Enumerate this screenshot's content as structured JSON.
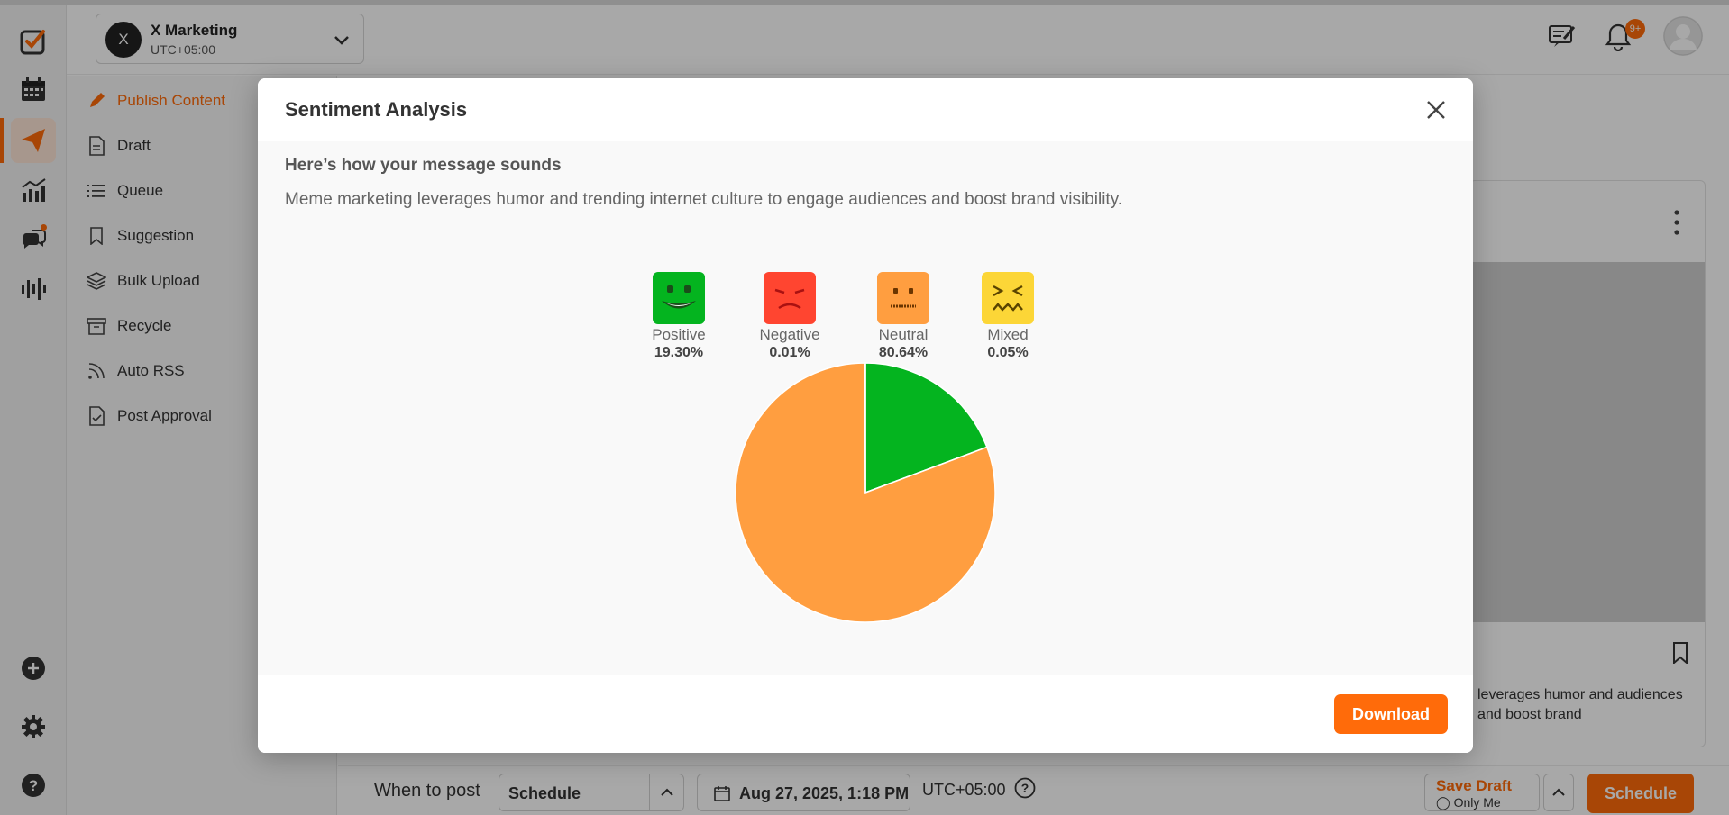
{
  "workspace": {
    "initial": "X",
    "name": "X Marketing",
    "timezone": "UTC+05:00"
  },
  "header": {
    "notification_badge": "9+"
  },
  "subnav": {
    "items": [
      {
        "label": "Publish Content",
        "icon": "pencil-icon",
        "active": true
      },
      {
        "label": "Draft",
        "icon": "document-icon"
      },
      {
        "label": "Queue",
        "icon": "list-icon"
      },
      {
        "label": "Suggestion",
        "icon": "bookmark-icon"
      },
      {
        "label": "Bulk Upload",
        "icon": "layers-icon"
      },
      {
        "label": "Recycle",
        "icon": "archive-icon"
      },
      {
        "label": "Auto RSS",
        "icon": "rss-icon"
      },
      {
        "label": "Post Approval",
        "icon": "approval-doc-icon"
      }
    ]
  },
  "preview": {
    "text": "leverages humor and audiences and boost brand"
  },
  "bottombar": {
    "when_label": "When to post",
    "schedule_select": "Schedule",
    "datetime": "Aug 27, 2025, 1:18 PM",
    "timezone": "UTC+05:00",
    "save_draft": "Save Draft",
    "save_draft_sub": "Only Me",
    "schedule_button": "Schedule"
  },
  "modal": {
    "title": "Sentiment Analysis",
    "subtitle": "Here’s how your message sounds",
    "message": "Meme marketing leverages humor and trending internet culture to engage audiences and boost brand visibility.",
    "download_label": "Download"
  },
  "colors": {
    "accent": "#ff6b0a",
    "positive": "#04b41f",
    "negative": "#ff4530",
    "neutral": "#ff9e40",
    "mixed": "#fcd637"
  },
  "chart_data": {
    "type": "pie",
    "title": "",
    "series": [
      {
        "name": "Positive",
        "value": 19.3,
        "label": "19.30%",
        "color": "#04b41f",
        "icon": "happy-face-icon"
      },
      {
        "name": "Negative",
        "value": 0.01,
        "label": "0.01%",
        "color": "#ff4530",
        "icon": "angry-face-icon"
      },
      {
        "name": "Neutral",
        "value": 80.64,
        "label": "80.64%",
        "color": "#ff9e40",
        "icon": "neutral-face-icon"
      },
      {
        "name": "Mixed",
        "value": 0.05,
        "label": "0.05%",
        "color": "#fcd637",
        "icon": "confounded-face-icon"
      }
    ],
    "legend_position": "top"
  }
}
